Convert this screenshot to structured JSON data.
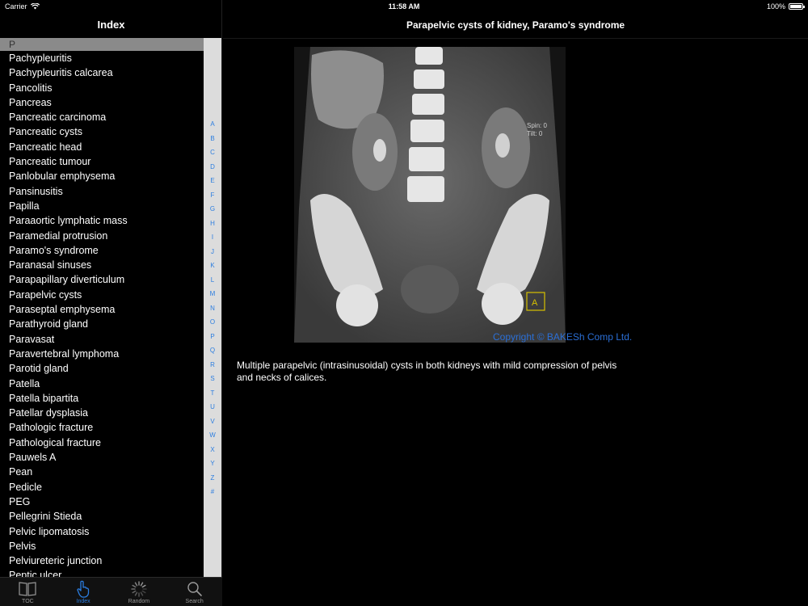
{
  "status_bar": {
    "carrier": "Carrier",
    "time": "11:58 AM",
    "battery": "100%",
    "battery_level": 1.0
  },
  "left_panel": {
    "title": "Index",
    "section_letter": "P",
    "items": [
      "Pachypleuritis",
      "Pachypleuritis calcarea",
      "Pancolitis",
      "Pancreas",
      "Pancreatic carcinoma",
      "Pancreatic cysts",
      "Pancreatic head",
      "Pancreatic tumour",
      "Panlobular emphysema",
      "Pansinusitis",
      "Papilla",
      "Paraaortic lymphatic mass",
      "Paramedial protrusion",
      "Paramo's syndrome",
      "Paranasal sinuses",
      "Parapapillary diverticulum",
      "Parapelvic cysts",
      "Paraseptal emphysema",
      "Parathyroid gland",
      "Paravasat",
      "Paravertebral lymphoma",
      "Parotid gland",
      "Patella",
      "Patella bipartita",
      "Patellar dysplasia",
      "Pathologic fracture",
      "Pathological fracture",
      "Pauwels A",
      "Pean",
      "Pedicle",
      "PEG",
      "Pellegrini Stieda",
      "Pelvic lipomatosis",
      "Pelvis",
      "Pelviureteric junction",
      "Peptic ulcer"
    ],
    "alpha_index": [
      "A",
      "B",
      "C",
      "D",
      "E",
      "F",
      "G",
      "H",
      "I",
      "J",
      "K",
      "L",
      "M",
      "N",
      "O",
      "P",
      "Q",
      "R",
      "S",
      "T",
      "U",
      "V",
      "W",
      "X",
      "Y",
      "Z",
      "#"
    ],
    "tabs": [
      {
        "label": "TOC",
        "icon": "book-icon",
        "active": false
      },
      {
        "label": "Index",
        "icon": "pointing-hand-icon",
        "active": true
      },
      {
        "label": "Random",
        "icon": "spinner-icon",
        "active": false
      },
      {
        "label": "Search",
        "icon": "search-icon",
        "active": false
      }
    ]
  },
  "detail": {
    "title": "Parapelvic cysts of kidney, Paramo's syndrome",
    "image": {
      "overlay_spin": "Spin:   0",
      "overlay_tilt": "Tilt:   0",
      "marker_letter": "A"
    },
    "copyright": "Copyright © BAKESh Comp Ltd.",
    "description": "Multiple parapelvic (intrasinusoidal) cysts in both kidneys with mild compression of pelvis and necks of calices."
  },
  "colors": {
    "accent": "#2b7de0",
    "background": "#000000",
    "index_bar": "#dcdcdc",
    "section_header": "#8a8a8a"
  }
}
